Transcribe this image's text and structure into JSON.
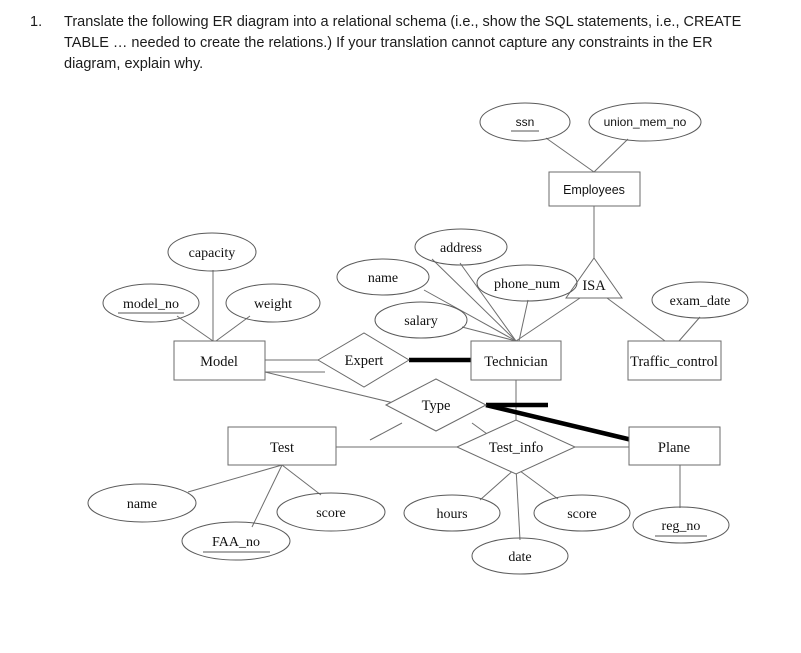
{
  "question": {
    "number": "1.",
    "text": "Translate the following ER diagram into a relational schema (i.e., show the SQL statements, i.e., CREATE TABLE … needed to create the relations.) If your translation cannot capture any constraints in the ER diagram, explain why."
  },
  "diagram": {
    "type": "er-diagram",
    "entities": [
      {
        "id": "employees",
        "label": "Employees"
      },
      {
        "id": "model",
        "label": "Model"
      },
      {
        "id": "technician",
        "label": "Technician"
      },
      {
        "id": "traffic_control",
        "label": "Traffic_control"
      },
      {
        "id": "test",
        "label": "Test"
      },
      {
        "id": "plane",
        "label": "Plane"
      }
    ],
    "relationships": [
      {
        "id": "expert",
        "label": "Expert"
      },
      {
        "id": "type",
        "label": "Type"
      },
      {
        "id": "test_info",
        "label": "Test_info"
      }
    ],
    "isa": {
      "id": "isa",
      "label": "ISA"
    },
    "attributes": [
      {
        "id": "ssn",
        "label": "ssn",
        "key": true,
        "owner": "employees"
      },
      {
        "id": "union_mem_no",
        "label": "union_mem_no",
        "key": false,
        "owner": "employees"
      },
      {
        "id": "capacity",
        "label": "capacity",
        "key": false,
        "owner": "model"
      },
      {
        "id": "model_no",
        "label": "model_no",
        "key": true,
        "owner": "model"
      },
      {
        "id": "weight",
        "label": "weight",
        "key": false,
        "owner": "model"
      },
      {
        "id": "name_tech",
        "label": "name",
        "key": false,
        "owner": "technician"
      },
      {
        "id": "address",
        "label": "address",
        "key": false,
        "owner": "technician"
      },
      {
        "id": "phone_num",
        "label": "phone_num",
        "key": false,
        "owner": "technician"
      },
      {
        "id": "salary",
        "label": "salary",
        "key": false,
        "owner": "technician"
      },
      {
        "id": "exam_date",
        "label": "exam_date",
        "key": false,
        "owner": "traffic_control"
      },
      {
        "id": "name_test",
        "label": "name",
        "key": false,
        "owner": "test"
      },
      {
        "id": "score_test",
        "label": "score",
        "key": false,
        "owner": "test"
      },
      {
        "id": "faa_no",
        "label": "FAA_no",
        "key": true,
        "owner": "test"
      },
      {
        "id": "hours",
        "label": "hours",
        "key": false,
        "owner": "test_info"
      },
      {
        "id": "score_info",
        "label": "score",
        "key": false,
        "owner": "test_info"
      },
      {
        "id": "date",
        "label": "date",
        "key": false,
        "owner": "test_info"
      },
      {
        "id": "reg_no",
        "label": "reg_no",
        "key": true,
        "owner": "plane"
      }
    ],
    "edges_thick": [
      {
        "from": "expert",
        "to": "technician"
      },
      {
        "from": "type",
        "to": "technician"
      },
      {
        "from": "type",
        "to": "plane"
      }
    ]
  }
}
